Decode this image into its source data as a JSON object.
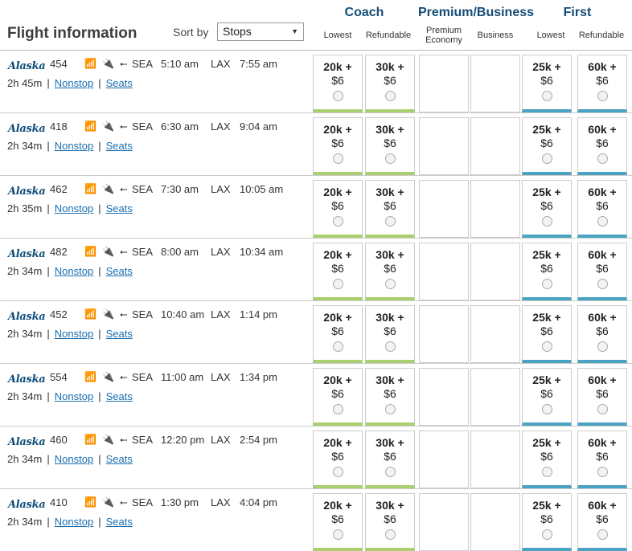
{
  "header": {
    "title": "Flight information",
    "sort_label": "Sort by",
    "sort_value": "Stops",
    "cabins": {
      "coach": "Coach",
      "premium": "Premium/Business",
      "first": "First"
    },
    "subcols": [
      "Lowest",
      "Refundable",
      "Premium Economy",
      "Business",
      "Lowest",
      "Refundable"
    ]
  },
  "flights": [
    {
      "airline": "Alaska",
      "number": "454",
      "origin": "SEA",
      "depart": "5:10 am",
      "dest": "LAX",
      "arrive": "7:55 am",
      "duration": "2h 45m",
      "stops": "Nonstop",
      "seats": "Seats",
      "coach_lowest": {
        "miles": "20k +",
        "tax": "$6"
      },
      "coach_ref": {
        "miles": "30k +",
        "tax": "$6"
      },
      "first_lowest": {
        "miles": "25k +",
        "tax": "$6"
      },
      "first_ref": {
        "miles": "60k +",
        "tax": "$6"
      }
    },
    {
      "airline": "Alaska",
      "number": "418",
      "origin": "SEA",
      "depart": "6:30 am",
      "dest": "LAX",
      "arrive": "9:04 am",
      "duration": "2h 34m",
      "stops": "Nonstop",
      "seats": "Seats",
      "coach_lowest": {
        "miles": "20k +",
        "tax": "$6"
      },
      "coach_ref": {
        "miles": "30k +",
        "tax": "$6"
      },
      "first_lowest": {
        "miles": "25k +",
        "tax": "$6"
      },
      "first_ref": {
        "miles": "60k +",
        "tax": "$6"
      }
    },
    {
      "airline": "Alaska",
      "number": "462",
      "origin": "SEA",
      "depart": "7:30 am",
      "dest": "LAX",
      "arrive": "10:05 am",
      "duration": "2h 35m",
      "stops": "Nonstop",
      "seats": "Seats",
      "coach_lowest": {
        "miles": "20k +",
        "tax": "$6"
      },
      "coach_ref": {
        "miles": "30k +",
        "tax": "$6"
      },
      "first_lowest": {
        "miles": "25k +",
        "tax": "$6"
      },
      "first_ref": {
        "miles": "60k +",
        "tax": "$6"
      }
    },
    {
      "airline": "Alaska",
      "number": "482",
      "origin": "SEA",
      "depart": "8:00 am",
      "dest": "LAX",
      "arrive": "10:34 am",
      "duration": "2h 34m",
      "stops": "Nonstop",
      "seats": "Seats",
      "coach_lowest": {
        "miles": "20k +",
        "tax": "$6"
      },
      "coach_ref": {
        "miles": "30k +",
        "tax": "$6"
      },
      "first_lowest": {
        "miles": "25k +",
        "tax": "$6"
      },
      "first_ref": {
        "miles": "60k +",
        "tax": "$6"
      }
    },
    {
      "airline": "Alaska",
      "number": "452",
      "origin": "SEA",
      "depart": "10:40 am",
      "dest": "LAX",
      "arrive": "1:14 pm",
      "duration": "2h 34m",
      "stops": "Nonstop",
      "seats": "Seats",
      "coach_lowest": {
        "miles": "20k +",
        "tax": "$6"
      },
      "coach_ref": {
        "miles": "30k +",
        "tax": "$6"
      },
      "first_lowest": {
        "miles": "25k +",
        "tax": "$6"
      },
      "first_ref": {
        "miles": "60k +",
        "tax": "$6"
      }
    },
    {
      "airline": "Alaska",
      "number": "554",
      "origin": "SEA",
      "depart": "11:00 am",
      "dest": "LAX",
      "arrive": "1:34 pm",
      "duration": "2h 34m",
      "stops": "Nonstop",
      "seats": "Seats",
      "coach_lowest": {
        "miles": "20k +",
        "tax": "$6"
      },
      "coach_ref": {
        "miles": "30k +",
        "tax": "$6"
      },
      "first_lowest": {
        "miles": "25k +",
        "tax": "$6"
      },
      "first_ref": {
        "miles": "60k +",
        "tax": "$6"
      }
    },
    {
      "airline": "Alaska",
      "number": "460",
      "origin": "SEA",
      "depart": "12:20 pm",
      "dest": "LAX",
      "arrive": "2:54 pm",
      "duration": "2h 34m",
      "stops": "Nonstop",
      "seats": "Seats",
      "coach_lowest": {
        "miles": "20k +",
        "tax": "$6"
      },
      "coach_ref": {
        "miles": "30k +",
        "tax": "$6"
      },
      "first_lowest": {
        "miles": "25k +",
        "tax": "$6"
      },
      "first_ref": {
        "miles": "60k +",
        "tax": "$6"
      }
    },
    {
      "airline": "Alaska",
      "number": "410",
      "origin": "SEA",
      "depart": "1:30 pm",
      "dest": "LAX",
      "arrive": "4:04 pm",
      "duration": "2h 34m",
      "stops": "Nonstop",
      "seats": "Seats",
      "coach_lowest": {
        "miles": "20k +",
        "tax": "$6"
      },
      "coach_ref": {
        "miles": "30k +",
        "tax": "$6"
      },
      "first_lowest": {
        "miles": "25k +",
        "tax": "$6"
      },
      "first_ref": {
        "miles": "60k +",
        "tax": "$6"
      }
    }
  ],
  "icons": [
    "wifi-icon",
    "power-icon",
    "usb-icon"
  ],
  "colors": {
    "coach_bar": "#a9cf6f",
    "first_bar": "#4aa3c2",
    "cabin_title": "#154d78",
    "link": "#1a6fb0"
  }
}
